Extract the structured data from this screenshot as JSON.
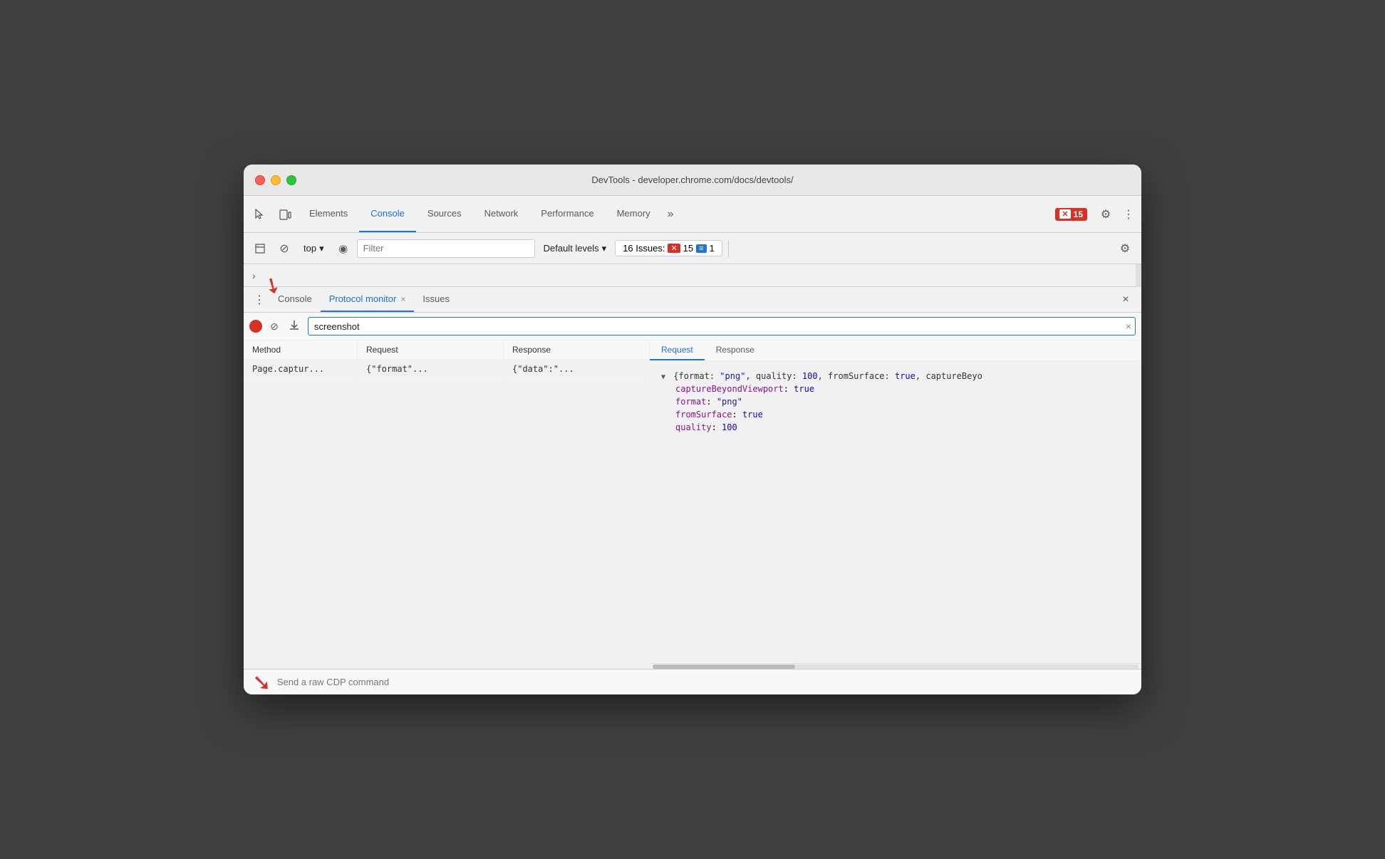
{
  "window": {
    "title": "DevTools - developer.chrome.com/docs/devtools/"
  },
  "tabs": [
    {
      "id": "elements",
      "label": "Elements",
      "active": false
    },
    {
      "id": "console",
      "label": "Console",
      "active": true
    },
    {
      "id": "sources",
      "label": "Sources",
      "active": false
    },
    {
      "id": "network",
      "label": "Network",
      "active": false
    },
    {
      "id": "performance",
      "label": "Performance",
      "active": false
    },
    {
      "id": "memory",
      "label": "Memory",
      "active": false
    }
  ],
  "error_badge": {
    "icon": "✕",
    "count": "15"
  },
  "console_toolbar": {
    "top_label": "top",
    "filter_placeholder": "Filter",
    "default_levels_label": "Default levels",
    "issues_label": "16 Issues:",
    "issues_error_count": "15",
    "issues_info_count": "1"
  },
  "drawer": {
    "tabs": [
      {
        "id": "console-tab",
        "label": "Console",
        "closeable": false
      },
      {
        "id": "protocol-monitor",
        "label": "Protocol monitor",
        "closeable": true,
        "active": true
      },
      {
        "id": "issues",
        "label": "Issues",
        "closeable": false
      }
    ]
  },
  "protocol_monitor": {
    "search_value": "screenshot",
    "table_headers": {
      "method": "Method",
      "request": "Request",
      "response": "Response"
    },
    "rows": [
      {
        "method": "Page.captur...",
        "request": "{\"format\"...",
        "response": "{\"data\":\"..."
      }
    ],
    "detail_tabs": [
      {
        "id": "request",
        "label": "Request",
        "active": true
      },
      {
        "id": "response",
        "label": "Response",
        "active": false
      }
    ],
    "detail_content": {
      "summary": "{format: \"png\", quality: 100, fromSurface: true, captureBeyo",
      "fields": [
        {
          "key": "captureBeyondViewport",
          "value": "true",
          "type": "bool"
        },
        {
          "key": "format",
          "value": "\"png\"",
          "type": "string"
        },
        {
          "key": "fromSurface",
          "value": "true",
          "type": "bool"
        },
        {
          "key": "quality",
          "value": "100",
          "type": "number"
        }
      ]
    }
  },
  "bottom_bar": {
    "placeholder": "Send a raw CDP command"
  },
  "icons": {
    "cursor": "⬚",
    "device": "⬚",
    "play": "▶",
    "ban": "⊘",
    "download": "↓",
    "eye": "◉",
    "gear": "⚙",
    "more_vert": "⋮",
    "chevron_right": ">",
    "three_dots": "⋮",
    "close": "×",
    "collapse": "▼",
    "dropdown": "▾"
  }
}
